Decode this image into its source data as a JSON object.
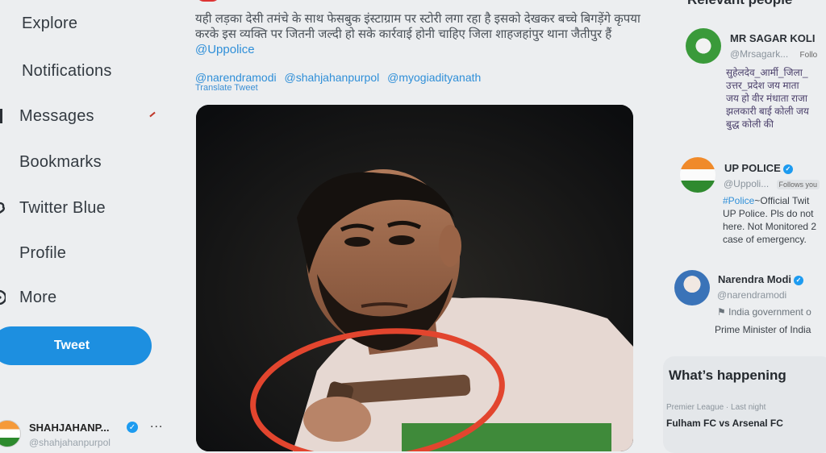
{
  "nav": {
    "items": [
      {
        "label": "Explore",
        "icon": "hash-icon"
      },
      {
        "label": "Notifications",
        "icon": "bell-icon"
      },
      {
        "label": "Messages",
        "icon": "mail-icon"
      },
      {
        "label": "Bookmarks",
        "icon": "bookmark-icon"
      },
      {
        "label": "Twitter Blue",
        "icon": "twitter-blue-icon"
      },
      {
        "label": "Profile",
        "icon": "person-icon"
      },
      {
        "label": "More",
        "icon": "more-circle-icon"
      }
    ],
    "tweet_button": "Tweet",
    "account": {
      "name": "SHAHJAHANP...",
      "handle": "@shahjahanpurpol",
      "more": "..."
    }
  },
  "tweet": {
    "text": "यही लड़का देसी तमंचे के साथ फेसबुक इंस्टाग्राम पर स्टोरी लगा रहा है इसको देखकर बच्चे बिगड़ेंगे कृपया करके इस व्यक्ति पर जितनी जल्दी हो सके कार्रवाई होनी चाहिए जिला शाहजहांपुर थाना जैतीपुर हैं",
    "inline_mention": "@Uppolice",
    "mentions": [
      "@narendramodi",
      "@shahjahanpurpol",
      "@myogiadityanath"
    ],
    "translate": "Translate Tweet",
    "photo_alt_icon": "photo-icon"
  },
  "sidebar": {
    "heading": "Relevant people",
    "people": [
      {
        "name": "MR SAGAR KOLI",
        "handle": "@Mrsagark...",
        "follow": "Follo",
        "bio": "सुहेलदेव_आर्मी_जिला_\nउत्तर_प्रदेश जय माता \nजय हो वीर मंधाता राजा\nझलकारी बाई कोली जय\nबुद्ध कोली की"
      },
      {
        "name": "UP POLICE",
        "handle": "@Uppoli...",
        "follows_you": "Follows you",
        "bio_tag": "#Police",
        "bio": "~Official Twit\nUP Police. Pls do not\nhere. Not Monitored 2\ncase of emergency."
      },
      {
        "name": "Narendra Modi",
        "handle": "@narendramodi",
        "label": "India government o",
        "bio": "Prime Minister of India"
      }
    ],
    "trends": {
      "title": "What’s happening",
      "meta": "Premier League · Last night",
      "name": "Fulham FC vs Arsenal FC"
    }
  },
  "colors": {
    "accent": "#1d8fe0",
    "link": "#2f8fd8",
    "verified": "#1d9bf0"
  }
}
